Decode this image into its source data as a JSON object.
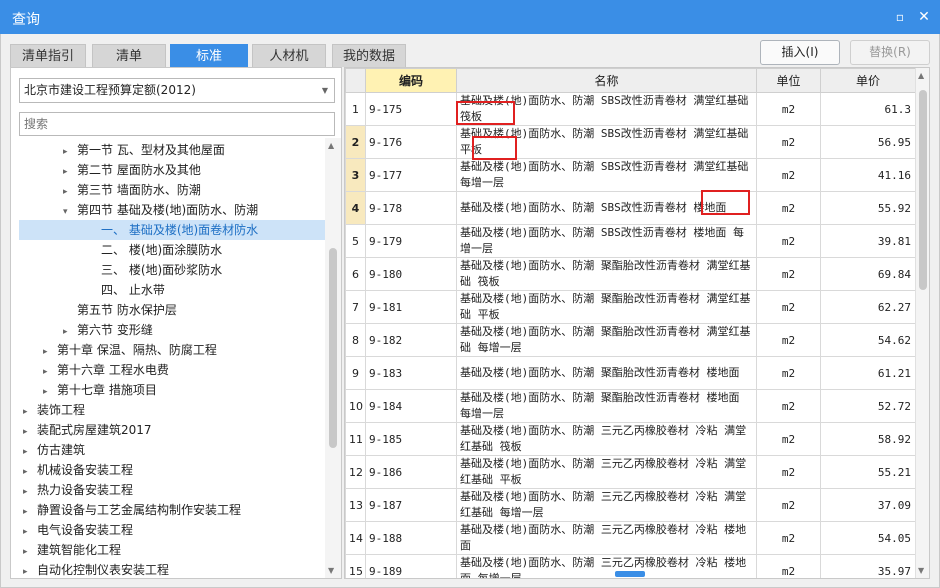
{
  "window": {
    "title": "查询",
    "maximize_icon": "▫",
    "close_icon": "✕"
  },
  "tabs": [
    {
      "label": "清单指引",
      "active": false
    },
    {
      "label": "清单",
      "active": false
    },
    {
      "label": "标准",
      "active": true
    },
    {
      "label": "人材机",
      "active": false
    },
    {
      "label": "我的数据",
      "active": false
    }
  ],
  "toolbar": {
    "insert_label": "插入(I)",
    "replace_label": "替换(R)"
  },
  "left": {
    "quota_select": "北京市建设工程预算定额(2012)",
    "search_placeholder": "搜索",
    "tree": [
      {
        "label": "第一节 瓦、型材及其他屋面",
        "expander": "▸"
      },
      {
        "label": "第二节 屋面防水及其他",
        "expander": "▸"
      },
      {
        "label": "第三节 墙面防水、防潮",
        "expander": "▸"
      },
      {
        "label": "第四节 基础及楼(地)面防水、防潮",
        "expander": "▾"
      },
      {
        "label": "一、 基础及楼(地)面卷材防水",
        "expander": ""
      },
      {
        "label": "二、 楼(地)面涂膜防水",
        "expander": ""
      },
      {
        "label": "三、 楼(地)面砂浆防水",
        "expander": ""
      },
      {
        "label": "四、 止水带",
        "expander": ""
      },
      {
        "label": "第五节 防水保护层",
        "expander": ""
      },
      {
        "label": "第六节 变形缝",
        "expander": "▸"
      },
      {
        "label": "第十章 保温、隔热、防腐工程",
        "expander": "▸"
      },
      {
        "label": "第十六章 工程水电费",
        "expander": "▸"
      },
      {
        "label": "第十七章 措施项目",
        "expander": "▸"
      },
      {
        "label": "装饰工程",
        "expander": "▸"
      },
      {
        "label": "装配式房屋建筑2017",
        "expander": "▸"
      },
      {
        "label": "仿古建筑",
        "expander": "▸"
      },
      {
        "label": "机械设备安装工程",
        "expander": "▸"
      },
      {
        "label": "热力设备安装工程",
        "expander": "▸"
      },
      {
        "label": "静置设备与工艺金属结构制作安装工程",
        "expander": "▸"
      },
      {
        "label": "电气设备安装工程",
        "expander": "▸"
      },
      {
        "label": "建筑智能化工程",
        "expander": "▸"
      },
      {
        "label": "自动化控制仪表安装工程",
        "expander": "▸"
      }
    ]
  },
  "table": {
    "headers": {
      "index": "",
      "code": "编码",
      "name": "名称",
      "unit": "单位",
      "price": "单价"
    },
    "rows": [
      {
        "idx": "1",
        "code": "9-175",
        "name": "基础及楼(地)面防水、防潮 SBS改性沥青卷材 满堂红基础 筏板",
        "unit": "m2",
        "price": "61.3"
      },
      {
        "idx": "2",
        "code": "9-176",
        "name": "基础及楼(地)面防水、防潮 SBS改性沥青卷材 满堂红基础 平板",
        "unit": "m2",
        "price": "56.95"
      },
      {
        "idx": "3",
        "code": "9-177",
        "name": "基础及楼(地)面防水、防潮 SBS改性沥青卷材 满堂红基础 每增一层",
        "unit": "m2",
        "price": "41.16"
      },
      {
        "idx": "4",
        "code": "9-178",
        "name": "基础及楼(地)面防水、防潮 SBS改性沥青卷材 楼地面",
        "unit": "m2",
        "price": "55.92"
      },
      {
        "idx": "5",
        "code": "9-179",
        "name": "基础及楼(地)面防水、防潮 SBS改性沥青卷材 楼地面 每增一层",
        "unit": "m2",
        "price": "39.81"
      },
      {
        "idx": "6",
        "code": "9-180",
        "name": "基础及楼(地)面防水、防潮 聚酯胎改性沥青卷材 满堂红基础 筏板",
        "unit": "m2",
        "price": "69.84"
      },
      {
        "idx": "7",
        "code": "9-181",
        "name": "基础及楼(地)面防水、防潮 聚酯胎改性沥青卷材 满堂红基础 平板",
        "unit": "m2",
        "price": "62.27"
      },
      {
        "idx": "8",
        "code": "9-182",
        "name": "基础及楼(地)面防水、防潮 聚酯胎改性沥青卷材 满堂红基础 每增一层",
        "unit": "m2",
        "price": "54.62"
      },
      {
        "idx": "9",
        "code": "9-183",
        "name": "基础及楼(地)面防水、防潮 聚酯胎改性沥青卷材 楼地面",
        "unit": "m2",
        "price": "61.21"
      },
      {
        "idx": "10",
        "code": "9-184",
        "name": "基础及楼(地)面防水、防潮 聚酯胎改性沥青卷材 楼地面 每增一层",
        "unit": "m2",
        "price": "52.72"
      },
      {
        "idx": "11",
        "code": "9-185",
        "name": "基础及楼(地)面防水、防潮 三元乙丙橡胶卷材 冷粘 满堂红基础 筏板",
        "unit": "m2",
        "price": "58.92"
      },
      {
        "idx": "12",
        "code": "9-186",
        "name": "基础及楼(地)面防水、防潮 三元乙丙橡胶卷材 冷粘 满堂红基础 平板",
        "unit": "m2",
        "price": "55.21"
      },
      {
        "idx": "13",
        "code": "9-187",
        "name": "基础及楼(地)面防水、防潮 三元乙丙橡胶卷材 冷粘 满堂红基础 每增一层",
        "unit": "m2",
        "price": "37.09"
      },
      {
        "idx": "14",
        "code": "9-188",
        "name": "基础及楼(地)面防水、防潮 三元乙丙橡胶卷材 冷粘 楼地面",
        "unit": "m2",
        "price": "54.05"
      },
      {
        "idx": "15",
        "code": "9-189",
        "name": "基础及楼(地)面防水、防潮 三元乙丙橡胶卷材 冷粘 楼地面 每增一层",
        "unit": "m2",
        "price": "35.97"
      }
    ]
  },
  "colors": {
    "accent": "#3a8ee6",
    "highlight_box": "#e02020",
    "selected_row_index": "#f8e9be"
  }
}
